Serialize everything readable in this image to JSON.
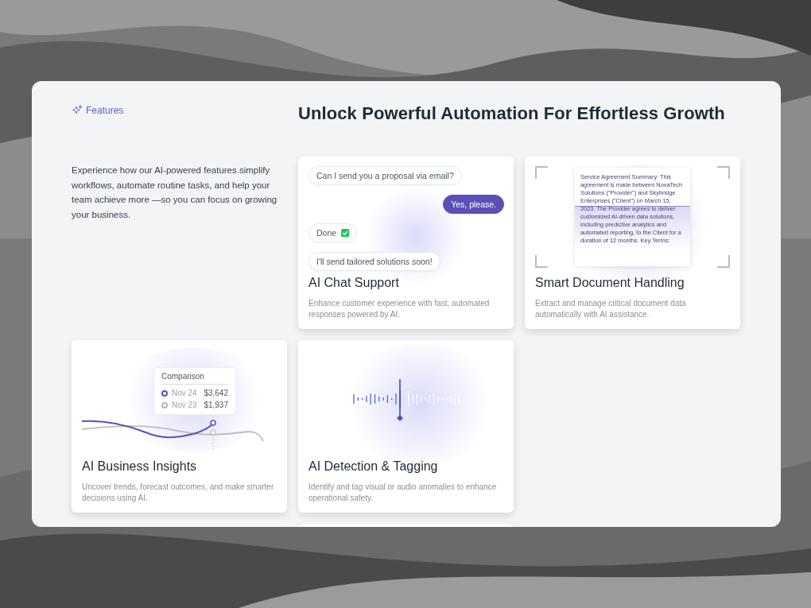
{
  "section_label": "Features",
  "heading": "Unlock Powerful Automation For Effortless Growth",
  "intro": "Experience how our AI-powered features simplify workflows, automate routine tasks, and help your team achieve more —so you can focus on growing your business.",
  "cards": [
    {
      "kind": "chat",
      "title": "AI Chat Support",
      "description": "Enhance customer experience with fast, automated responses powered by AI.",
      "messages": [
        {
          "text": "Can I send you a proposal via email?",
          "outgoing": false,
          "confirmed": false
        },
        {
          "text": "Yes, please.",
          "outgoing": true,
          "confirmed": false
        },
        {
          "text": "Done",
          "outgoing": false,
          "confirmed": true
        },
        {
          "text": "I'll send tailored solutions soon!",
          "outgoing": false,
          "confirmed": false
        }
      ]
    },
    {
      "kind": "document",
      "title": "Smart Document Handling",
      "description": "Extract and manage critical document data automatically with AI assistance.",
      "document_text": "Service Agreement Summary: This agreement is made between NovaTech Solutions (\"Provider\") and Skybridge Enterprises (\"Client\") on March 15, 2023. The Provider agrees to deliver customized AI-driven data solutions, including predictive analytics and automated reporting, to the Client for a duration of 12 months. Key Terms:"
    },
    {
      "kind": "insights",
      "title": "AI Business Insights",
      "description": "Uncover trends, forecast outcomes, and make smarter decisions using AI.",
      "tooltip": {
        "title": "Comparison",
        "rows": [
          {
            "date": "Nov 24",
            "value": "$3,642",
            "color": "#5b50b8"
          },
          {
            "date": "Nov 23",
            "value": "$1,937",
            "color": "#b5b5b5"
          }
        ]
      }
    },
    {
      "kind": "waveform",
      "title": "AI Detection & Tagging",
      "description": "Identify and tag visual or audio anomalies to enhance operational safety."
    }
  ]
}
